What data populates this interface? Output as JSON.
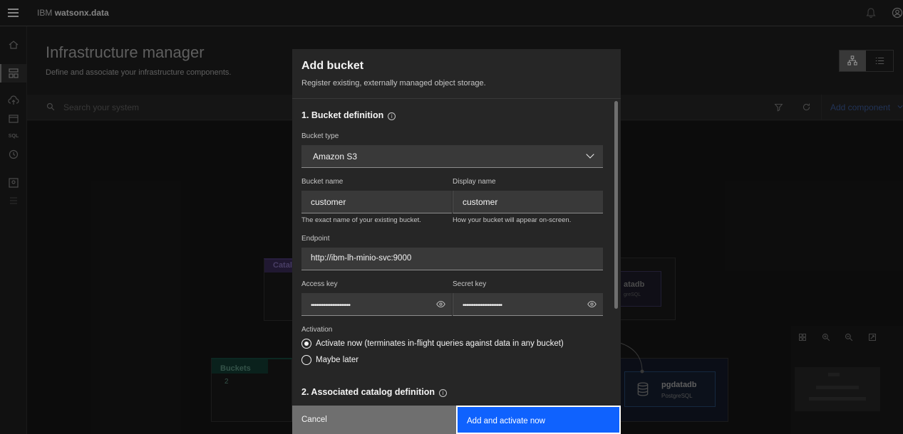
{
  "header": {
    "brand_prefix": "IBM",
    "brand_name": "watsonx.data"
  },
  "page": {
    "title": "Infrastructure manager",
    "subtitle": "Define and associate your infrastructure components."
  },
  "toolbar": {
    "search_placeholder": "Search your system",
    "add_component_label": "Add component"
  },
  "canvas": {
    "catalog_label": "Catal",
    "buckets_label": "Buckets",
    "buckets_count": "2",
    "db_node_1_name": "atadb",
    "db_node_1_type": "greSQL",
    "db_node_2_name": "pgdatadb",
    "db_node_2_type": "PostgreSQL"
  },
  "modal": {
    "title": "Add bucket",
    "subtitle": "Register existing, externally managed object storage.",
    "section1_title": "1. Bucket definition",
    "section2_title": "2. Associated catalog definition",
    "bucket_type_label": "Bucket type",
    "bucket_type_value": "Amazon S3",
    "bucket_name_label": "Bucket name",
    "bucket_name_value": "customer",
    "bucket_name_helper": "The exact name of your existing bucket.",
    "display_name_label": "Display name",
    "display_name_value": "customer",
    "display_name_helper": "How your bucket will appear on-screen.",
    "endpoint_label": "Endpoint",
    "endpoint_value": "http://ibm-lh-minio-svc:9000",
    "access_key_label": "Access key",
    "access_key_value": "••••••••••••••••••••••",
    "secret_key_label": "Secret key",
    "secret_key_value": "••••••••••••••••••••••",
    "activation_label": "Activation",
    "activation_options": [
      "Activate now (terminates in-flight queries against data in any bucket)",
      "Maybe later"
    ],
    "cancel_label": "Cancel",
    "primary_label": "Add and activate now"
  }
}
